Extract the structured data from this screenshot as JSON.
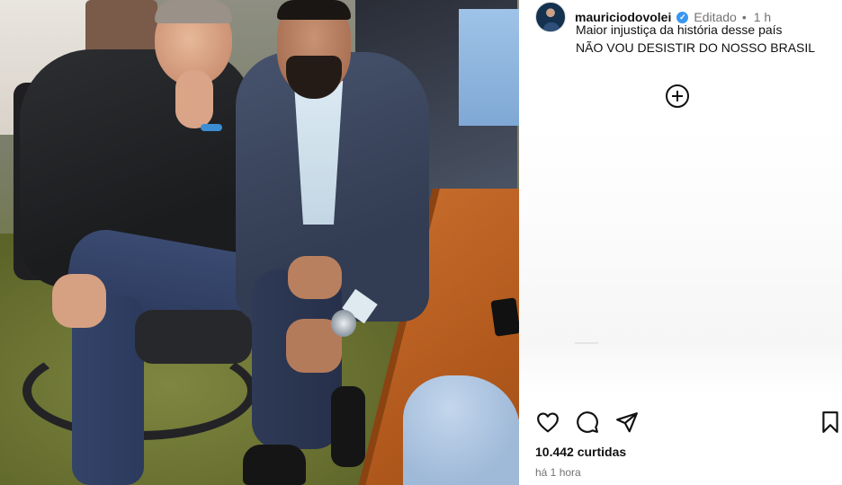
{
  "post": {
    "username": "mauriciodovolei",
    "edited_label": "Editado",
    "separator": "•",
    "time_short": "1 h",
    "caption_line1": "Maior injustiça da história desse país",
    "caption_line2": "NÃO VOU DESISTIR DO NOSSO BRASIL",
    "likes": "10.442 curtidas",
    "time_long": "há 1 hora"
  },
  "icons": {
    "verified": "verified-badge-icon",
    "add": "plus-circle-icon",
    "like": "heart-icon",
    "comment": "comment-bubble-icon",
    "share": "send-icon",
    "save": "bookmark-icon"
  },
  "colors": {
    "verified_blue": "#3897f0",
    "muted_text": "#737373",
    "text": "#111111"
  }
}
